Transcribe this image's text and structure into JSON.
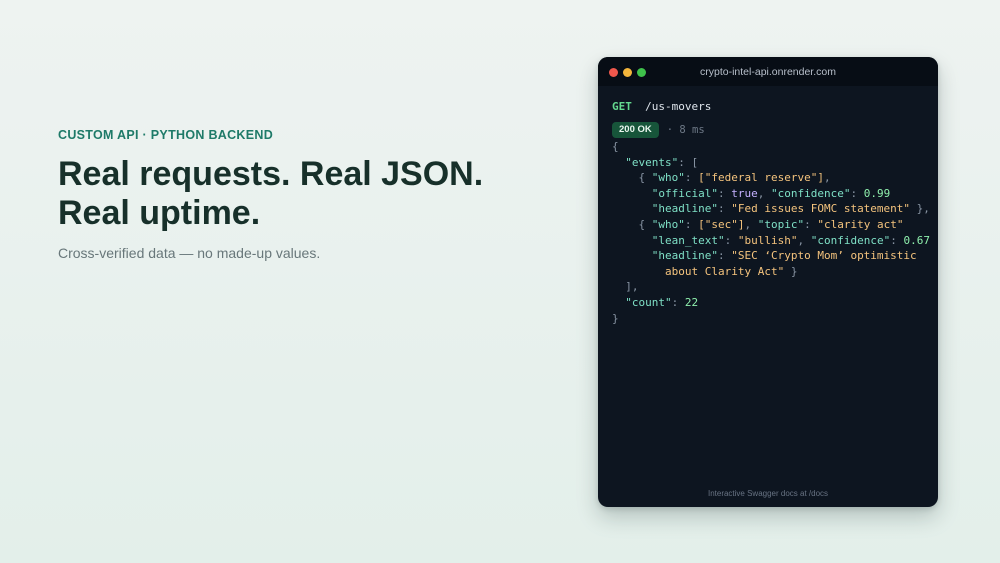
{
  "hero": {
    "eyebrow": "CUSTOM API · PYTHON BACKEND",
    "headline_line1": "Real requests. Real JSON.",
    "headline_line2": "Real uptime.",
    "subtitle": "Cross-verified data — no made-up values."
  },
  "terminal": {
    "host": "crypto-intel-api.onrender.com",
    "method": "GET",
    "path": "/us-movers",
    "status": "200 OK",
    "latency": "· 8 ms",
    "footer": "Interactive Swagger docs at  /docs",
    "window_dots": [
      "#f0584d",
      "#f3b53b",
      "#3fc14b"
    ],
    "json_lines": [
      {
        "indent": "",
        "tokens": [
          {
            "t": "p",
            "v": "{"
          }
        ]
      },
      {
        "indent": "  ",
        "tokens": [
          {
            "t": "k",
            "v": "\"events\""
          },
          {
            "t": "p",
            "v": ": ["
          }
        ]
      },
      {
        "indent": "    ",
        "tokens": [
          {
            "t": "p",
            "v": "{ "
          },
          {
            "t": "k",
            "v": "\"who\""
          },
          {
            "t": "p",
            "v": ": "
          },
          {
            "t": "s",
            "v": "[\"federal reserve\"]"
          },
          {
            "t": "p",
            "v": ","
          }
        ]
      },
      {
        "indent": "      ",
        "tokens": [
          {
            "t": "k",
            "v": "\"official\""
          },
          {
            "t": "p",
            "v": ": "
          },
          {
            "t": "b",
            "v": "true"
          },
          {
            "t": "p",
            "v": ", "
          },
          {
            "t": "k",
            "v": "\"confidence\""
          },
          {
            "t": "p",
            "v": ": "
          },
          {
            "t": "n",
            "v": "0.99"
          }
        ]
      },
      {
        "indent": "      ",
        "tokens": [
          {
            "t": "k",
            "v": "\"headline\""
          },
          {
            "t": "p",
            "v": ": "
          },
          {
            "t": "s",
            "v": "\"Fed issues FOMC statement\""
          },
          {
            "t": "p",
            "v": " },"
          }
        ]
      },
      {
        "indent": "    ",
        "tokens": [
          {
            "t": "p",
            "v": "{ "
          },
          {
            "t": "k",
            "v": "\"who\""
          },
          {
            "t": "p",
            "v": ": "
          },
          {
            "t": "s",
            "v": "[\"sec\"]"
          },
          {
            "t": "p",
            "v": ", "
          },
          {
            "t": "k",
            "v": "\"topic\""
          },
          {
            "t": "p",
            "v": ": "
          },
          {
            "t": "s",
            "v": "\"clarity act\""
          }
        ]
      },
      {
        "indent": "      ",
        "tokens": [
          {
            "t": "k",
            "v": "\"lean_text\""
          },
          {
            "t": "p",
            "v": ": "
          },
          {
            "t": "s",
            "v": "\"bullish\""
          },
          {
            "t": "p",
            "v": ", "
          },
          {
            "t": "k",
            "v": "\"confidence\""
          },
          {
            "t": "p",
            "v": ": "
          },
          {
            "t": "n",
            "v": "0.67"
          }
        ]
      },
      {
        "indent": "      ",
        "tokens": [
          {
            "t": "k",
            "v": "\"headline\""
          },
          {
            "t": "p",
            "v": ": "
          },
          {
            "t": "s",
            "v": "\"SEC ‘Crypto Mom’ optimistic"
          }
        ]
      },
      {
        "indent": "        ",
        "tokens": [
          {
            "t": "s",
            "v": "about Clarity Act\""
          },
          {
            "t": "p",
            "v": " }"
          }
        ]
      },
      {
        "indent": "  ",
        "tokens": [
          {
            "t": "p",
            "v": "],"
          }
        ]
      },
      {
        "indent": "  ",
        "tokens": [
          {
            "t": "k",
            "v": "\"count\""
          },
          {
            "t": "p",
            "v": ": "
          },
          {
            "t": "n",
            "v": "22"
          }
        ]
      },
      {
        "indent": "",
        "tokens": [
          {
            "t": "p",
            "v": "}"
          }
        ]
      }
    ]
  }
}
